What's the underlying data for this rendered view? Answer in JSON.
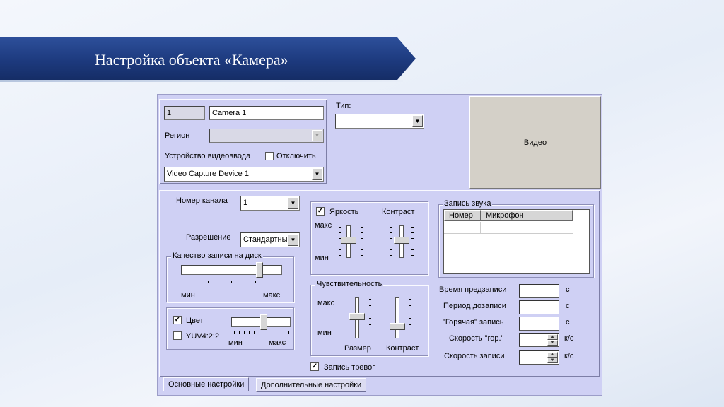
{
  "slide": {
    "title": "Настройка объекта «Камера»"
  },
  "dialog": {
    "id_value": "1",
    "name_value": "Camera 1",
    "region_label": "Регион",
    "region_value": "",
    "device_label": "Устройство видеоввода",
    "disable_label": "Отключить",
    "disable_checked": false,
    "device_value": "Video Capture Device 1",
    "type_label": "Тип:",
    "type_value": "",
    "video_label": "Видео",
    "channel_label": "Номер канала",
    "channel_value": "1",
    "resolution_label": "Разрешение",
    "resolution_value": "Стандартный",
    "quality_group": "Качество записи на диск",
    "quality_min": "мин",
    "quality_max": "макс",
    "quality_level": 0.8,
    "color_label": "Цвет",
    "color_checked": true,
    "yuv_label": "YUV4:2:2",
    "yuv_checked": false,
    "color_min": "мин",
    "color_max": "макс",
    "color_level": 0.55,
    "brightness_label": "Яркость",
    "brightness_checked": true,
    "contrast_label": "Контраст",
    "bc_max": "макс",
    "bc_min": "мин",
    "sensitivity_group": "Чувствительность",
    "sens_max": "макс",
    "sens_min": "мин",
    "size_label": "Размер",
    "sens_contrast_label": "Контраст",
    "alarm_label": "Запись тревог",
    "alarm_checked": true,
    "audio_group": "Запись звука",
    "audio_columns": [
      "Номер",
      "Микрофон"
    ],
    "prerecord_label": "Время предзаписи",
    "prerecord_unit": "с",
    "postrecord_label": "Период дозаписи",
    "postrecord_unit": "с",
    "hot_label": "\"Горячая\" запись",
    "hot_unit": "с",
    "hot_speed_label": "Скорость \"гор.\"",
    "hot_speed_unit": "к/с",
    "rec_speed_label": "Скорость записи",
    "rec_speed_unit": "к/с",
    "tabs": [
      "Основные настройки",
      "Дополнительные настройки"
    ]
  }
}
